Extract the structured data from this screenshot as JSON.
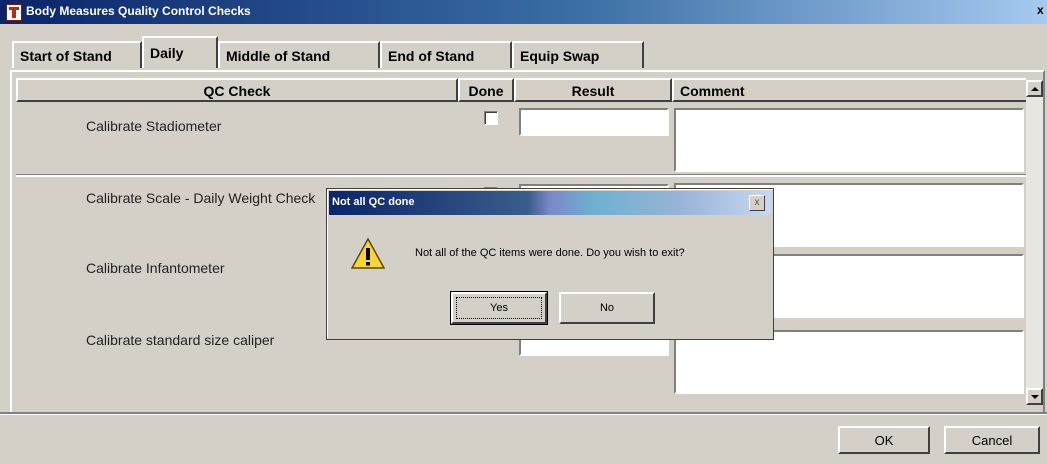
{
  "window": {
    "title": "Body Measures Quality Control Checks",
    "close_label": "x"
  },
  "tabs": [
    {
      "label": "Start of Stand"
    },
    {
      "label": "Daily"
    },
    {
      "label": "Middle of Stand"
    },
    {
      "label": "End of Stand"
    },
    {
      "label": "Equip Swap"
    }
  ],
  "grid": {
    "headers": {
      "qc_check": "QC Check",
      "done": "Done",
      "result": "Result",
      "comment": "Comment"
    },
    "rows": [
      {
        "label": "Calibrate Stadiometer",
        "done": false,
        "result": "",
        "comment": ""
      },
      {
        "label": "Calibrate Scale - Daily Weight Check",
        "done": false,
        "result": "",
        "comment": ""
      },
      {
        "label": "Calibrate Infantometer",
        "done": false,
        "result": "",
        "comment": ""
      },
      {
        "label": "Calibrate standard size caliper",
        "done": false,
        "result": "",
        "comment": ""
      }
    ]
  },
  "footer": {
    "ok_label": "OK",
    "cancel_label": "Cancel"
  },
  "dialog": {
    "title": "Not all QC done",
    "close_label": "x",
    "icon": "warning-icon",
    "message": "Not all of the QC items were done. Do you wish to exit?",
    "yes_label": "Yes",
    "no_label": "No"
  }
}
